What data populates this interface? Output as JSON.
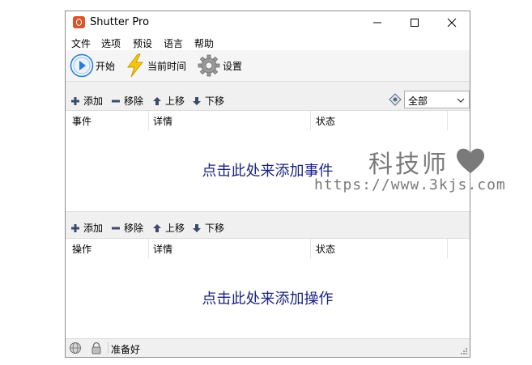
{
  "window": {
    "title": "Shutter Pro"
  },
  "menu": [
    "文件",
    "选项",
    "预设",
    "语言",
    "帮助"
  ],
  "toolbar": {
    "start": "开始",
    "current_time": "当前时间",
    "settings": "设置"
  },
  "events_bar": {
    "add": "添加",
    "remove": "移除",
    "up": "上移",
    "down": "下移",
    "filter_value": "全部"
  },
  "events_table": {
    "columns": [
      "事件",
      "详情",
      "状态"
    ],
    "hint": "点击此处来添加事件"
  },
  "actions_bar": {
    "add": "添加",
    "remove": "移除",
    "up": "上移",
    "down": "下移"
  },
  "actions_table": {
    "columns": [
      "操作",
      "详情",
      "状态"
    ],
    "hint": "点击此处来添加操作"
  },
  "statusbar": {
    "text": "准备好"
  },
  "watermark": {
    "name": "科技师",
    "url": "https://www.3kjs.com"
  },
  "colors": {
    "hint": "#1a237e",
    "accent": "#2b7bd8",
    "bolt": "#f2c80f",
    "app_icon": "#d9552b"
  }
}
